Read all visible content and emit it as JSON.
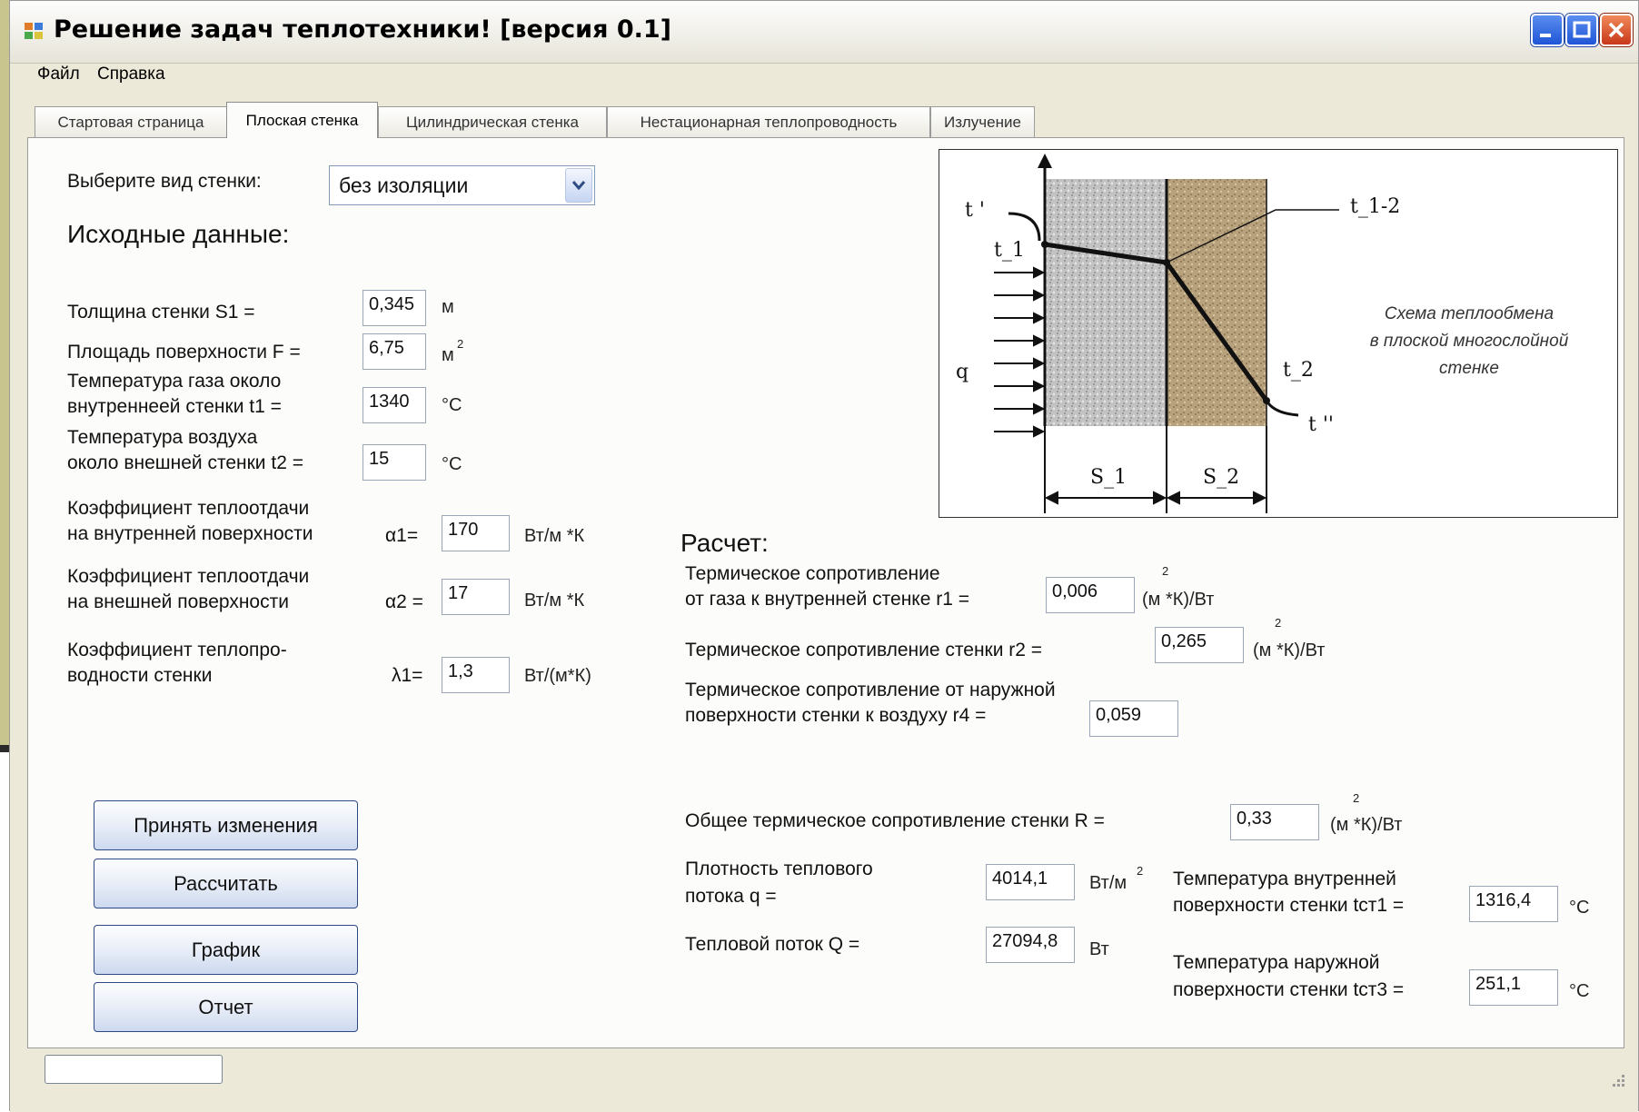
{
  "window": {
    "title": "Решение задач теплотехники! [версия 0.1]"
  },
  "menu": {
    "file": "Файл",
    "help": "Справка"
  },
  "tabs": [
    {
      "label": "Стартовая страница"
    },
    {
      "label": "Плоская стенка"
    },
    {
      "label": "Цилиндрическая стенка"
    },
    {
      "label": "Нестационарная теплопроводность"
    },
    {
      "label": "Излучение"
    }
  ],
  "wall": {
    "prompt": "Выберите вид стенки:",
    "type_value": "без изоляции"
  },
  "input": {
    "heading": "Исходные данные:",
    "thickness_label": "Толщина стенки S1 =",
    "thickness_value": "0,345",
    "thickness_unit": "м",
    "area_label": "Площадь поверхности F =",
    "area_value": "6,75",
    "area_unit": "м",
    "area_unit_sup": "2",
    "gas_temp_label_1": "Температура газа около",
    "gas_temp_label_2": "внутреннеей стенки t1 =",
    "gas_temp_value": "1340",
    "gas_temp_unit": "°С",
    "air_temp_label_1": "Температура воздуха",
    "air_temp_label_2": " около внешней стенки t2 =",
    "air_temp_value": "15",
    "air_temp_unit": "°С",
    "alpha1_label_1": "Коэффициент теплоотдачи",
    "alpha1_label_2": " на внутренней поверхности",
    "alpha1_symbol": "α1=",
    "alpha1_value": "170",
    "alpha1_unit": "Вт/м  *К",
    "alpha2_label_1": "Коэффициент теплоотдачи",
    "alpha2_label_2": " на внешней поверхности",
    "alpha2_symbol": "α2 =",
    "alpha2_value": "17",
    "alpha2_unit": "Вт/м  *К",
    "lambda_label_1": "Коэффициент теплопро-",
    "lambda_label_2": "водности  стенки",
    "lambda_symbol": "λ1=",
    "lambda_value": "1,3",
    "lambda_unit": "Вт/(м*К)"
  },
  "buttons": {
    "apply": "Принять изменения",
    "calculate": "Рассчитать",
    "chart": "График",
    "report": "Отчет"
  },
  "calc": {
    "heading": "Расчет:",
    "r1_label_1": "Термическое сопротивление",
    "r1_label_2": "от газа к внутренней стенке r1 =",
    "r1_value": "0,006",
    "r_unit": "(м  *К)/Вт",
    "r_unit_sup": "2",
    "r2_label": "Термическое сопротивление стенки r2 =",
    "r2_value": "0,265",
    "r4_label_1": "Термическое сопротивление от наружной",
    "r4_label_2": " поверхности стенки к воздуху r4 =",
    "r4_value": "0,059",
    "R_label": "Общее термическое сопротивление стенки R =",
    "R_value": "0,33",
    "q_label_1": "Плотность теплового",
    "q_label_2": "потока q =",
    "q_value": "4014,1",
    "q_unit": "Вт/м",
    "q_unit_sup": "2",
    "Q_label": "Тепловой поток  Q =",
    "Q_value": "27094,8",
    "Q_unit": "Вт",
    "tct1_label_1": "Температура внутренней",
    "tct1_label_2": "поверхности стенки  tст1 =",
    "tct1_value": "1316,4",
    "tct1_unit": "°С",
    "tct3_label_1": "Температура наружной",
    "tct3_label_2": "поверхности стенки   tст3 =",
    "tct3_value": "251,1",
    "tct3_unit": "°С"
  },
  "diagram": {
    "caption_1": "Схема теплообмена",
    "caption_2": "в плоской многослойной",
    "caption_3": "стенке",
    "t_prime": "t '",
    "t1": "t_1",
    "t12": "t_1-2",
    "q": "q",
    "t2": "t_2",
    "t_dprime": "t ''",
    "s1": "S_1",
    "s2": "S_2"
  },
  "colors": {
    "window_bg": "#ece9d8",
    "panel_bg": "#fcfcfb",
    "title_close": "#c8381a",
    "title_btn": "#1f56d6",
    "layer1": "#bdbdbd",
    "layer2": "#b8a27e"
  }
}
